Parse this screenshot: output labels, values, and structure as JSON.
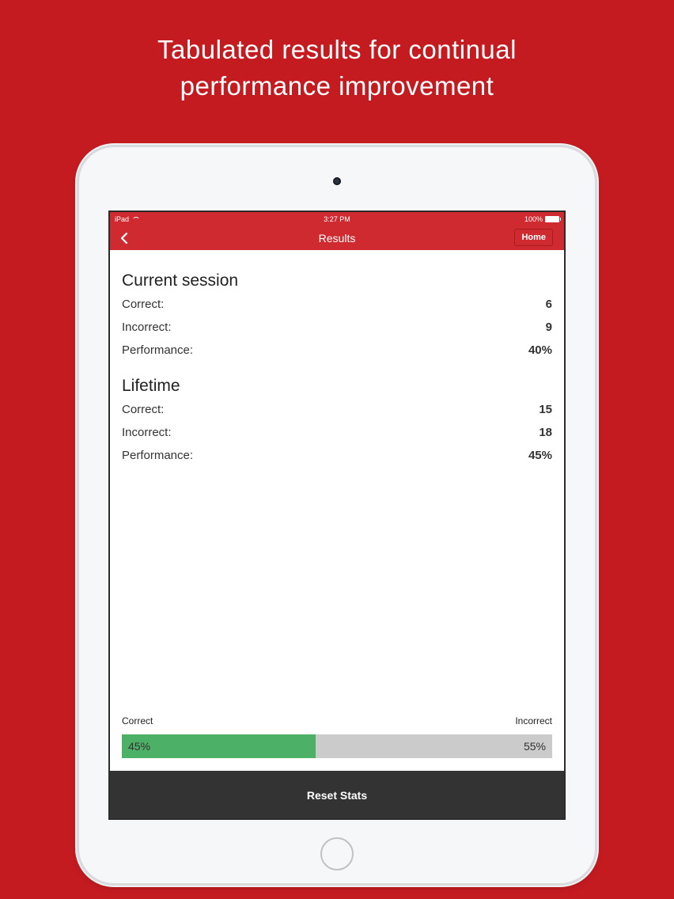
{
  "promo": {
    "line1": "Tabulated results for continual",
    "line2": "performance improvement"
  },
  "statusbar": {
    "carrier": "iPad",
    "time": "3:27 PM",
    "battery": "100%"
  },
  "navbar": {
    "title": "Results",
    "home_label": "Home"
  },
  "current_session": {
    "title": "Current session",
    "rows": [
      {
        "label": "Correct:",
        "value": "6"
      },
      {
        "label": "Incorrect:",
        "value": "9"
      },
      {
        "label": "Performance:",
        "value": "40%"
      }
    ]
  },
  "lifetime": {
    "title": "Lifetime",
    "rows": [
      {
        "label": "Correct:",
        "value": "15"
      },
      {
        "label": "Incorrect:",
        "value": "18"
      },
      {
        "label": "Performance:",
        "value": "45%"
      }
    ]
  },
  "progress": {
    "correct_label": "Correct",
    "incorrect_label": "Incorrect",
    "correct_text": "45%",
    "incorrect_text": "55%",
    "correct_fraction": 0.45
  },
  "reset_label": "Reset Stats",
  "colors": {
    "background": "#c41b21",
    "bar_correct": "#4cb066",
    "bar_incorrect": "#cbcbcb",
    "nav": "#cf2a2f"
  },
  "icons": {
    "back": "chevron-left-icon",
    "wifi": "wifi-icon",
    "battery": "battery-icon"
  }
}
